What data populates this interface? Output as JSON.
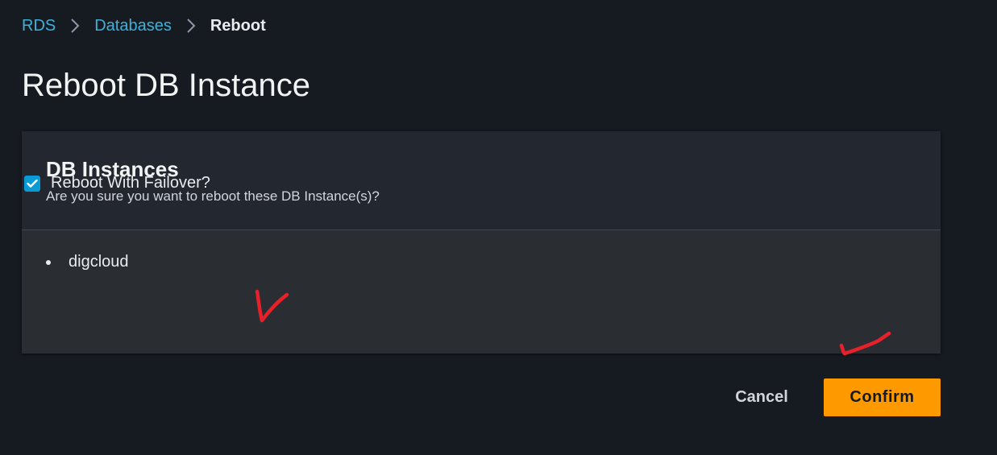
{
  "breadcrumb": {
    "items": [
      {
        "label": "RDS"
      },
      {
        "label": "Databases"
      },
      {
        "label": "Reboot"
      }
    ]
  },
  "page": {
    "title": "Reboot DB Instance"
  },
  "panel": {
    "title": "DB Instances",
    "description": "Are you sure you want to reboot these DB Instance(s)?",
    "instances": [
      "digcloud"
    ],
    "failover_label": "Reboot With Failover?",
    "failover_checked": true
  },
  "actions": {
    "cancel_label": "Cancel",
    "confirm_label": "Confirm"
  },
  "colors": {
    "background": "#161a21",
    "link": "#3fb0d9",
    "primary_button": "#ff9900",
    "checkbox": "#0a9bd6",
    "annotation": "#e8202a"
  }
}
